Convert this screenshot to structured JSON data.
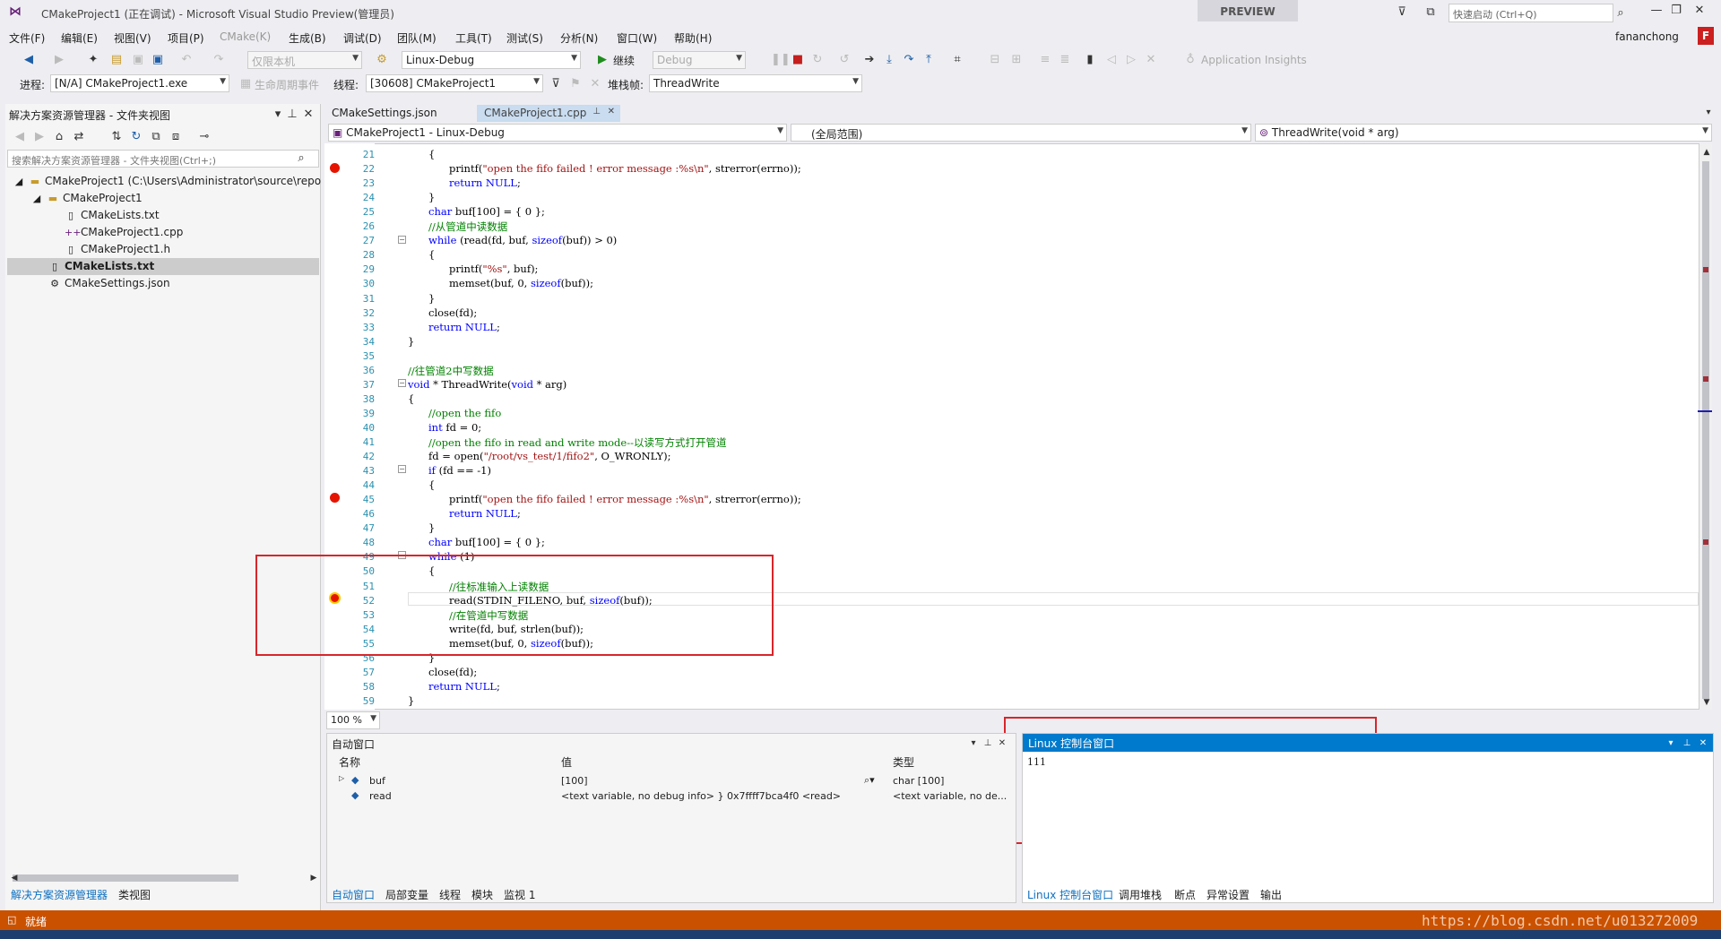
{
  "window": {
    "title": "CMakeProject1 (正在调试) - Microsoft Visual Studio Preview(管理员)",
    "preview_badge": "PREVIEW",
    "quick_launch_placeholder": "快速启动 (Ctrl+Q)",
    "user": "fananchong",
    "user_initial": "F"
  },
  "menu": [
    "文件(F)",
    "编辑(E)",
    "视图(V)",
    "项目(P)",
    "CMake(K)",
    "生成(B)",
    "调试(D)",
    "团队(M)",
    "工具(T)",
    "测试(S)",
    "分析(N)",
    "窗口(W)",
    "帮助(H)"
  ],
  "toolbar1": {
    "target": "仅限本机",
    "config": "Linux-Debug",
    "continue": "继续",
    "debug_combo": "Debug",
    "app_insights": "Application Insights"
  },
  "toolbar2": {
    "process_label": "进程:",
    "process": "[N/A] CMakeProject1.exe",
    "lifecycle": "生命周期事件",
    "thread_label": "线程:",
    "thread": "[30608] CMakeProject1",
    "stack_label": "堆栈帧:",
    "stack": "ThreadWrite"
  },
  "solution_explorer": {
    "title": "解决方案资源管理器 - 文件夹视图",
    "search_placeholder": "搜索解决方案资源管理器 - 文件夹视图(Ctrl+;)",
    "items": [
      {
        "label": "CMakeProject1 (C:\\Users\\Administrator\\source\\repo",
        "icon": "folder-icon"
      },
      {
        "label": "CMakeProject1",
        "icon": "folder-icon"
      },
      {
        "label": "CMakeLists.txt",
        "icon": "file-icon"
      },
      {
        "label": "CMakeProject1.cpp",
        "icon": "cpp-file-icon"
      },
      {
        "label": "CMakeProject1.h",
        "icon": "header-file-icon"
      },
      {
        "label": "CMakeLists.txt",
        "icon": "file-icon"
      },
      {
        "label": "CMakeSettings.json",
        "icon": "json-file-icon"
      }
    ],
    "bottom_tabs": [
      "解决方案资源管理器",
      "类视图"
    ]
  },
  "editor": {
    "tabs": [
      "CMakeSettings.json",
      "CMakeProject1.cpp"
    ],
    "nav_project": "CMakeProject1 - Linux-Debug",
    "nav_scope": "(全局范围)",
    "nav_function": "ThreadWrite(void * arg)",
    "zoom": "100 %",
    "lines": [
      {
        "n": "21",
        "t": "{",
        "i": 1
      },
      {
        "n": "22",
        "t": "printf(\"open the fifo failed ! error message :%s\\n\", strerror(errno));",
        "i": 2
      },
      {
        "n": "23",
        "t": "return NULL;",
        "i": 2
      },
      {
        "n": "24",
        "t": "}",
        "i": 1
      },
      {
        "n": "25",
        "t": "char buf[100] = { 0 };",
        "i": 1
      },
      {
        "n": "26",
        "t": "//从管道中读数据",
        "i": 1
      },
      {
        "n": "27",
        "t": "while (read(fd, buf, sizeof(buf)) > 0)",
        "i": 1
      },
      {
        "n": "28",
        "t": "{",
        "i": 1
      },
      {
        "n": "29",
        "t": "printf(\"%s\", buf);",
        "i": 2
      },
      {
        "n": "30",
        "t": "memset(buf, 0, sizeof(buf));",
        "i": 2
      },
      {
        "n": "31",
        "t": "}",
        "i": 1
      },
      {
        "n": "32",
        "t": "close(fd);",
        "i": 1
      },
      {
        "n": "33",
        "t": "return NULL;",
        "i": 1
      },
      {
        "n": "34",
        "t": "}",
        "i": 0
      },
      {
        "n": "35",
        "t": "",
        "i": 0
      },
      {
        "n": "36",
        "t": "//往管道2中写数据",
        "i": 0
      },
      {
        "n": "37",
        "t": "void * ThreadWrite(void * arg)",
        "i": 0
      },
      {
        "n": "38",
        "t": "{",
        "i": 0
      },
      {
        "n": "39",
        "t": "//open the fifo",
        "i": 1
      },
      {
        "n": "40",
        "t": "int fd = 0;",
        "i": 1
      },
      {
        "n": "41",
        "t": "//open the fifo in read and write mode--以读写方式打开管道",
        "i": 1
      },
      {
        "n": "42",
        "t": "fd = open(\"/root/vs_test/1/fifo2\", O_WRONLY);",
        "i": 1
      },
      {
        "n": "43",
        "t": "if (fd == -1)",
        "i": 1
      },
      {
        "n": "44",
        "t": "{",
        "i": 1
      },
      {
        "n": "45",
        "t": "printf(\"open the fifo failed ! error message :%s\\n\", strerror(errno));",
        "i": 2
      },
      {
        "n": "46",
        "t": "return NULL;",
        "i": 2
      },
      {
        "n": "47",
        "t": "}",
        "i": 1
      },
      {
        "n": "48",
        "t": "char buf[100] = { 0 };",
        "i": 1
      },
      {
        "n": "49",
        "t": "while (1)",
        "i": 1
      },
      {
        "n": "50",
        "t": "{",
        "i": 1
      },
      {
        "n": "51",
        "t": "//往标准输入上读数据",
        "i": 2
      },
      {
        "n": "52",
        "t": "read(STDIN_FILENO, buf, sizeof(buf));",
        "i": 2
      },
      {
        "n": "53",
        "t": "//在管道中写数据",
        "i": 2
      },
      {
        "n": "54",
        "t": "write(fd, buf, strlen(buf));",
        "i": 2
      },
      {
        "n": "55",
        "t": "memset(buf, 0, sizeof(buf));",
        "i": 2
      },
      {
        "n": "56",
        "t": "}",
        "i": 1
      },
      {
        "n": "57",
        "t": "close(fd);",
        "i": 1
      },
      {
        "n": "58",
        "t": "return NULL;",
        "i": 1
      },
      {
        "n": "59",
        "t": "}",
        "i": 0
      }
    ]
  },
  "autos": {
    "title": "自动窗口",
    "col_name": "名称",
    "col_value": "值",
    "col_type": "类型",
    "rows": [
      {
        "name": "buf",
        "value": "[100]",
        "type": "char [100]"
      },
      {
        "name": "read",
        "value": "<text variable, no debug info> } 0x7ffff7bca4f0 <read>",
        "type": "<text variable, no de..."
      }
    ],
    "bottom_tabs": [
      "自动窗口",
      "局部变量",
      "线程",
      "模块",
      "监视 1"
    ]
  },
  "linux_console": {
    "title": "Linux 控制台窗口",
    "output": "111",
    "bottom_tabs": [
      "Linux 控制台窗口",
      "调用堆栈",
      "断点",
      "异常设置",
      "输出"
    ]
  },
  "status": {
    "text": "就绪",
    "watermark": "https://blog.csdn.net/u013272009"
  },
  "colors": {
    "accent": "#007acc",
    "status_bar": "#ca5100",
    "breakpoint": "#e51400",
    "highlight_box": "#d7262b"
  }
}
